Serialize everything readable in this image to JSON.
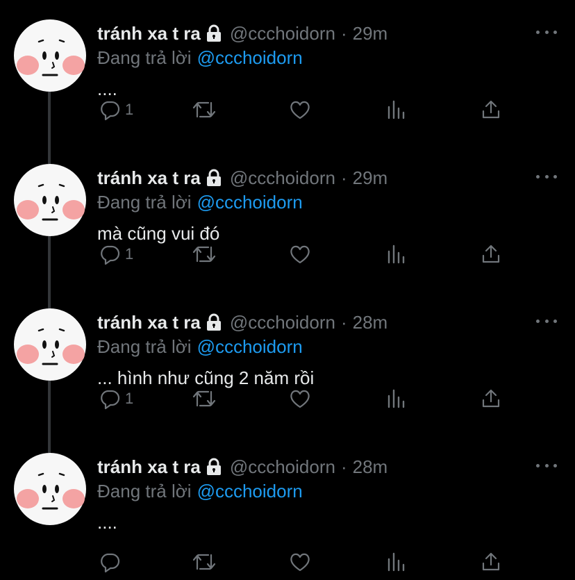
{
  "tweets": [
    {
      "name": "tránh xa t ra",
      "handle": "@ccchoidorn",
      "time": "29m",
      "reply_label": "Đang trả lời",
      "reply_to": "@ccchoidorn",
      "text": "....",
      "reply_count": "1",
      "has_thread_line": true
    },
    {
      "name": "tránh xa t ra",
      "handle": "@ccchoidorn",
      "time": "29m",
      "reply_label": "Đang trả lời",
      "reply_to": "@ccchoidorn",
      "text": "mà cũng vui đó",
      "reply_count": "1",
      "has_thread_line": true
    },
    {
      "name": "tránh xa t ra",
      "handle": "@ccchoidorn",
      "time": "28m",
      "reply_label": "Đang trả lời",
      "reply_to": "@ccchoidorn",
      "text": "... hình như cũng 2 năm rồi",
      "reply_count": "1",
      "has_thread_line": true
    },
    {
      "name": "tránh xa t ra",
      "handle": "@ccchoidorn",
      "time": "28m",
      "reply_label": "Đang trả lời",
      "reply_to": "@ccchoidorn",
      "text": "....",
      "reply_count": "",
      "has_thread_line": false
    }
  ],
  "icons": {
    "lock": "lock-icon",
    "more": "more-icon",
    "reply": "reply-icon",
    "retweet": "retweet-icon",
    "like": "like-icon",
    "views": "views-icon",
    "share": "share-icon"
  },
  "colors": {
    "background": "#000000",
    "text": "#e7e9ea",
    "secondary": "#71767b",
    "link": "#1d9bf0",
    "thread_line": "#333639",
    "avatar_face": "#f7f7f7",
    "avatar_blush": "#f4a3a3"
  },
  "separator": "·"
}
